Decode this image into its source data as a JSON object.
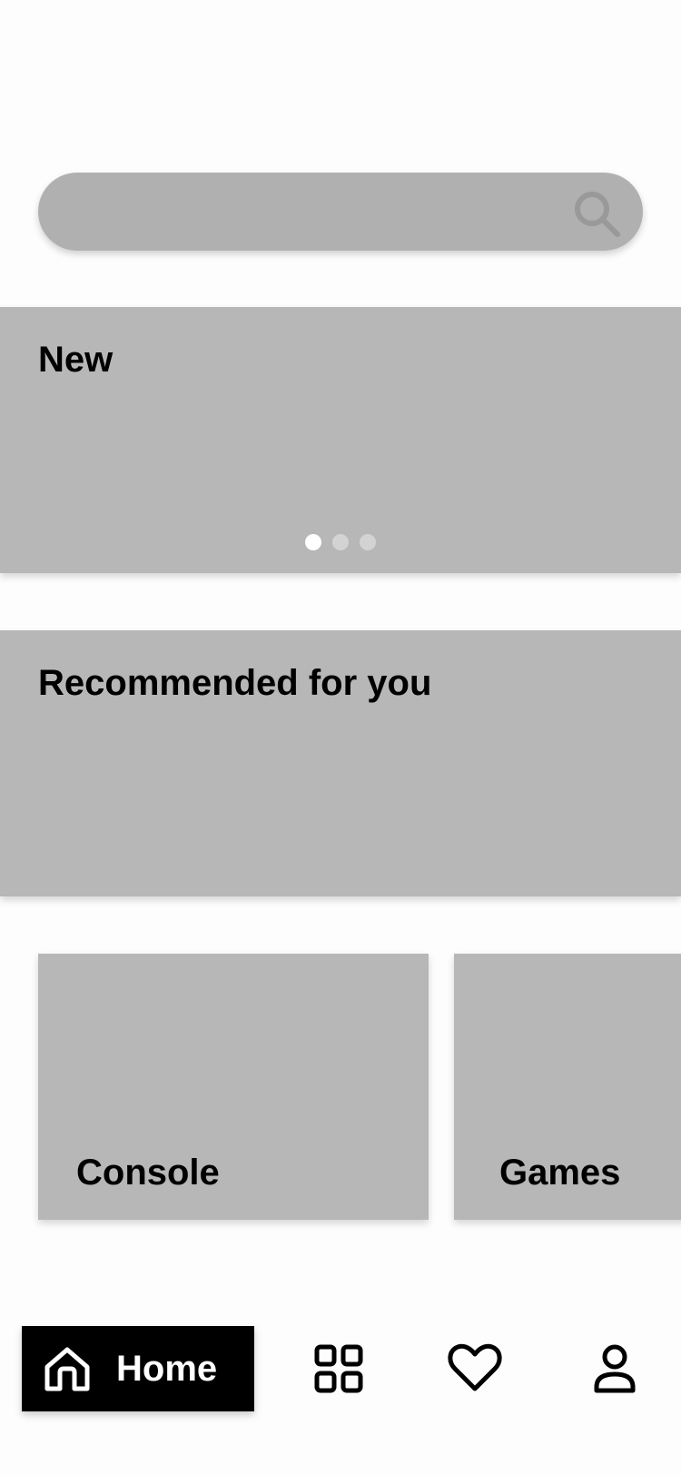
{
  "search": {
    "icon": "search-icon"
  },
  "banners": {
    "new_title": "New",
    "recommended_title": "Recommended for you",
    "carousel_pages": 3,
    "carousel_active_index": 0
  },
  "categories": {
    "items": [
      {
        "label": "Console"
      },
      {
        "label": "Games"
      }
    ]
  },
  "bottom_nav": {
    "home_label": "Home",
    "items": [
      {
        "icon": "home-icon",
        "active": true
      },
      {
        "icon": "grid-icon",
        "active": false
      },
      {
        "icon": "heart-icon",
        "active": false
      },
      {
        "icon": "profile-icon",
        "active": false
      }
    ]
  },
  "colors": {
    "placeholder_gray": "#b7b7b7",
    "search_gray": "#b0b0b0",
    "active_nav_bg": "#000000",
    "active_nav_text": "#ffffff",
    "dot_active": "#ffffff",
    "dot_inactive": "#d3d3d3"
  }
}
